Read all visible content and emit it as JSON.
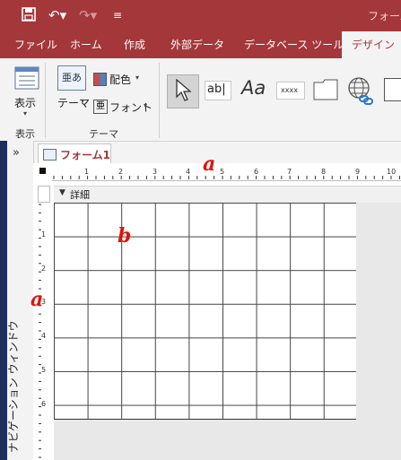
{
  "window": {
    "title": "フォーム"
  },
  "tabs": [
    {
      "label": "ファイル"
    },
    {
      "label": "ホーム"
    },
    {
      "label": "作成"
    },
    {
      "label": "外部データ"
    },
    {
      "label": "データベース ツール"
    },
    {
      "label": "デザイン",
      "active": true
    }
  ],
  "ribbon": {
    "view": {
      "label": "表示",
      "group": "表示"
    },
    "theme": {
      "themes_label": "テーマ",
      "colors_label": "配色",
      "fonts_label": "フォント",
      "group": "テーマ"
    },
    "controls": {
      "textbox_label": "ab|",
      "label_label": "Aa",
      "button_label": "xxxx"
    }
  },
  "nav_pane": {
    "label": "ナビゲーション ウィンドウ",
    "toggle": "»"
  },
  "document": {
    "tab_label": "フォーム1",
    "section_label": "詳細"
  },
  "ruler": {
    "h_ticks": [
      "1",
      "2",
      "3",
      "4",
      "5",
      "6",
      "7",
      "8",
      "9",
      "10"
    ],
    "v_ticks": [
      "1",
      "2",
      "3",
      "4",
      "5",
      "6"
    ]
  },
  "annotations": {
    "a_top": "a",
    "a_left": "a",
    "b": "b"
  },
  "colors": {
    "accent": "#a4373a",
    "annotation": "#e3120b"
  }
}
